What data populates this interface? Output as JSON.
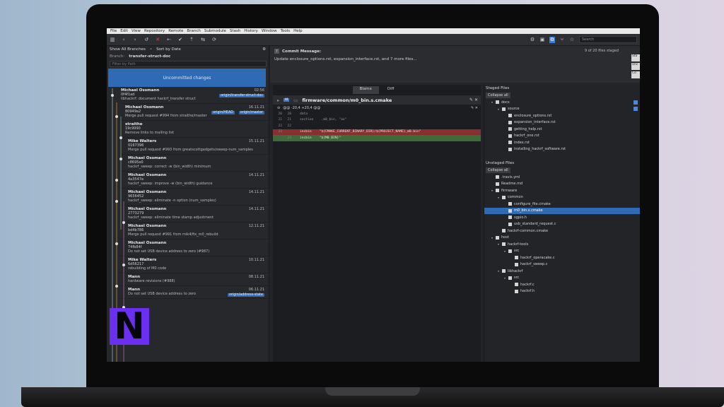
{
  "menu": [
    "File",
    "Edit",
    "View",
    "Repository",
    "Remote",
    "Branch",
    "Submodule",
    "Stash",
    "History",
    "Window",
    "Tools",
    "Help"
  ],
  "toolbar": {
    "search_placeholder": "Search"
  },
  "left": {
    "show_all": "Show All Branches",
    "sort": "Sort by Date",
    "branch_label": "Branch:",
    "branch_value": "transfer-struct-doc",
    "filter_placeholder": "Filter by Path",
    "uncommitted": "Uncommitted changes",
    "commits": [
      {
        "author": "Michael Ossmann",
        "hash": "0f4f1ad",
        "msg": "libhackrf: document hackrf_transfer struct",
        "date": "02:56",
        "tag": "origin/transfer-struct-doc"
      },
      {
        "author": "Michael Ossmann",
        "hash": "80949a2",
        "msg": "Merge pull request #994 from straithe/master",
        "date": "16.11.21",
        "tag": "origin/HEAD",
        "tag2": "origin/master"
      },
      {
        "author": "straithe",
        "hash": "19c9990",
        "msg": "Remove links to mailing list",
        "date": "",
        "tag": ""
      },
      {
        "author": "Mike Walters",
        "hash": "0167396",
        "msg": "Merge pull request #993 from greatscottgadgets/sweep-num_samples",
        "date": "15.11.21",
        "tag": ""
      },
      {
        "author": "Michael Ossmann",
        "hash": "c8695e0",
        "msg": "hackrf_sweep: correct -w (bin_width) minimum",
        "date": "",
        "tag": ""
      },
      {
        "author": "Michael Ossmann",
        "hash": "4a3547e",
        "msg": "hackrf_sweep: improve -w (bin_width) guidance",
        "date": "14.11.21",
        "tag": ""
      },
      {
        "author": "Michael Ossmann",
        "hash": "9656452",
        "msg": "hackrf_sweep: eliminate -n option (num_samples)",
        "date": "14.11.21",
        "tag": ""
      },
      {
        "author": "Michael Ossmann",
        "hash": "2773279",
        "msg": "hackrf_sweep: eliminate time stamp adjustment",
        "date": "14.11.21",
        "tag": ""
      },
      {
        "author": "Michael Ossmann",
        "hash": "bd4b786",
        "msg": "Merge pull request #991 from mik4/fix_m0_rebuild",
        "date": "12.11.21",
        "tag": ""
      },
      {
        "author": "Michael Ossmann",
        "hash": "74fb84f",
        "msg": "Do not set USB device address to zero (#987)",
        "date": "",
        "tag": ""
      },
      {
        "author": "Mike Walters",
        "hash": "6d56217",
        "msg": "rebuilding of M0 code",
        "date": "10.11.21",
        "tag": ""
      },
      {
        "author": "Mann",
        "hash": "",
        "msg": "hardware revisions (#988)",
        "date": "08.11.21",
        "tag": ""
      },
      {
        "author": "Mann",
        "hash": "",
        "msg": "Do not set USB device address to zero",
        "date": "06.11.21",
        "tag": "origin/address-state"
      }
    ]
  },
  "commit_area": {
    "label": "Commit Message:",
    "message": "Update enclosure_options.rst, expansion_interface.rst, and 7 more files...",
    "staged_count": "9 of 20 files staged",
    "side_buttons": [
      "Sta",
      "Unc",
      "Co"
    ]
  },
  "diff": {
    "tabs": [
      "Blame",
      "Diff"
    ],
    "file_badge": "M",
    "file_path": "firmware/common/m0_bin.s.cmake",
    "hunk": "@@ -20,4 +20,4 @@",
    "lines": [
      {
        "n1": "20",
        "n2": "20",
        "type": "ctx",
        "code": "data"
      },
      {
        "n1": "21",
        "n2": "21",
        "type": "ctx",
        "code": "section    .m0_bin, \"ax\""
      },
      {
        "n1": "22",
        "n2": "22",
        "type": "ctx",
        "code": ""
      },
      {
        "n1": "23",
        "n2": "",
        "type": "del",
        "code": "incbin    \"${CMAKE_CURRENT_BINARY_DIR}/${PROJECT_NAME}_m0.bin\""
      },
      {
        "n1": "",
        "n2": "23",
        "type": "add",
        "code": "incbin    \"${M0_BIN}\""
      }
    ]
  },
  "staged": {
    "title": "Staged Files",
    "collapse": "Collapse all",
    "items": [
      {
        "label": "docs",
        "level": 0,
        "folder": true
      },
      {
        "label": "source",
        "level": 1,
        "folder": true
      },
      {
        "label": "enclosure_options.rst",
        "level": 2
      },
      {
        "label": "expansion_interface.rst",
        "level": 2
      },
      {
        "label": "getting_help.rst",
        "level": 2
      },
      {
        "label": "hackrf_one.rst",
        "level": 2
      },
      {
        "label": "index.rst",
        "level": 2
      },
      {
        "label": "installing_hackrf_software.rst",
        "level": 2
      }
    ]
  },
  "unstaged": {
    "title": "Unstaged Files",
    "collapse": "Collapse all",
    "items": [
      {
        "label": ".travis.yml",
        "level": 0
      },
      {
        "label": "Readme.md",
        "level": 0
      },
      {
        "label": "firmware",
        "level": 0,
        "folder": true
      },
      {
        "label": "common",
        "level": 1,
        "folder": true
      },
      {
        "label": "configure_file.cmake",
        "level": 2
      },
      {
        "label": "m0_bin.s.cmake",
        "level": 2,
        "selected": true
      },
      {
        "label": "sgpio.h",
        "level": 2
      },
      {
        "label": "usb_standard_request.c",
        "level": 2
      },
      {
        "label": "hackrf-common.cmake",
        "level": 1
      },
      {
        "label": "host",
        "level": 0,
        "folder": true
      },
      {
        "label": "hackrf-tools",
        "level": 1,
        "folder": true
      },
      {
        "label": "src",
        "level": 2,
        "folder": true
      },
      {
        "label": "hackrf_operacake.c",
        "level": 3
      },
      {
        "label": "hackrf_sweep.c",
        "level": 3
      },
      {
        "label": "libhackrf",
        "level": 1,
        "folder": true
      },
      {
        "label": "src",
        "level": 2,
        "folder": true
      },
      {
        "label": "hackrf.c",
        "level": 3
      },
      {
        "label": "hackrf.h",
        "level": 3
      }
    ]
  },
  "colors": {
    "accent": "#2f6ab4",
    "delete": "#8a2f2f",
    "add": "#3d6b3a",
    "logo": "#6a2ff0"
  }
}
